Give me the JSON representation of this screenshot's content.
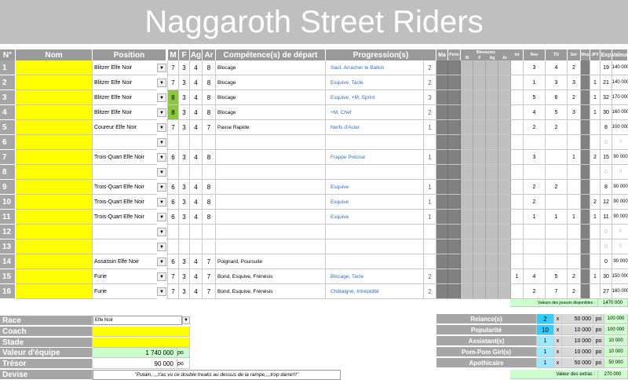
{
  "team_name": "Naggaroth Street Riders",
  "headers": {
    "no": "N°",
    "nom": "Nom",
    "position": "Position",
    "m": "M",
    "f": "F",
    "ag": "Ag",
    "ar": "Ar",
    "competences": "Compétence(s) de départ",
    "progression": "Progression(s)",
    "ma": "Ma",
    "pert": "Perte",
    "blessures": "Blessures",
    "bm": "M",
    "bf": "F",
    "bag": "Ag",
    "bar": "Ar",
    "int": "Int",
    "reu": "Reu",
    "td": "TD",
    "sor": "Sor",
    "mvp": "Mvp",
    "jpv": "JPV",
    "exp": "Exp",
    "valeur": "Valeur"
  },
  "players": [
    {
      "n": "1",
      "position": "Blitzer Elfe Noir",
      "m": "7",
      "f": "3",
      "ag": "4",
      "ar": "8",
      "m_up": false,
      "skills": "Blocage",
      "progression": "Saut, Arracher le Ballon",
      "prog_count": "2",
      "int": "",
      "reu": "3",
      "td": "4",
      "sor": "2",
      "mvp": "",
      "exp": "19",
      "valeur": "140 000",
      "empty": false
    },
    {
      "n": "2",
      "position": "Blitzer Elfe Noir",
      "m": "7",
      "f": "3",
      "ag": "4",
      "ar": "8",
      "m_up": false,
      "skills": "Blocage",
      "progression": "Esquive, Tacle",
      "prog_count": "2",
      "int": "",
      "reu": "1",
      "td": "3",
      "sor": "3",
      "mvp": "1",
      "exp": "21",
      "valeur": "140 000",
      "empty": false
    },
    {
      "n": "3",
      "position": "Blitzer Elfe Noir",
      "m": "8",
      "f": "3",
      "ag": "4",
      "ar": "8",
      "m_up": true,
      "skills": "Blocage",
      "progression": "Esquive,  +M, Sprint",
      "prog_count": "3",
      "int": "",
      "reu": "5",
      "td": "6",
      "sor": "2",
      "mvp": "1",
      "exp": "32",
      "valeur": "170 000",
      "empty": false
    },
    {
      "n": "4",
      "position": "Blitzer Elfe Noir",
      "m": "8",
      "f": "3",
      "ag": "4",
      "ar": "8",
      "m_up": true,
      "skills": "Blocage",
      "progression": " +M, Chef",
      "prog_count": "2",
      "int": "",
      "reu": "4",
      "td": "5",
      "sor": "3",
      "mvp": "1",
      "exp": "30",
      "valeur": "160 000",
      "empty": false
    },
    {
      "n": "5",
      "position": "Coureur Elfe Noir",
      "m": "7",
      "f": "3",
      "ag": "4",
      "ar": "7",
      "m_up": false,
      "skills": "Passe Rapide",
      "progression": "Nerfs d'Acier",
      "prog_count": "1",
      "int": "",
      "reu": "2",
      "td": "2",
      "sor": "",
      "mvp": "",
      "exp": "8",
      "valeur": "100 000",
      "empty": false
    },
    {
      "n": "6",
      "position": "",
      "m": "",
      "f": "",
      "ag": "",
      "ar": "",
      "m_up": false,
      "skills": "",
      "progression": "",
      "prog_count": "",
      "int": "",
      "reu": "",
      "td": "",
      "sor": "",
      "mvp": "",
      "exp": "0",
      "valeur": "0",
      "empty": true
    },
    {
      "n": "7",
      "position": "Trois-Quart Elfe Noir",
      "m": "6",
      "f": "3",
      "ag": "4",
      "ar": "8",
      "m_up": false,
      "skills": "",
      "progression": "Frappe Précise",
      "prog_count": "1",
      "int": "",
      "reu": "3",
      "td": "",
      "sor": "1",
      "mvp": "2",
      "exp": "15",
      "valeur": "90 000",
      "empty": false
    },
    {
      "n": "8",
      "position": "",
      "m": "",
      "f": "",
      "ag": "",
      "ar": "",
      "m_up": false,
      "skills": "",
      "progression": "",
      "prog_count": "",
      "int": "",
      "reu": "",
      "td": "",
      "sor": "",
      "mvp": "",
      "exp": "0",
      "valeur": "0",
      "empty": true
    },
    {
      "n": "9",
      "position": "Trois-Quart Elfe Noir",
      "m": "6",
      "f": "3",
      "ag": "4",
      "ar": "8",
      "m_up": false,
      "skills": "",
      "progression": "Esquive",
      "prog_count": "1",
      "int": "",
      "reu": "2",
      "td": "2",
      "sor": "",
      "mvp": "",
      "exp": "8",
      "valeur": "90 000",
      "empty": false
    },
    {
      "n": "10",
      "position": "Trois-Quart Elfe Noir",
      "m": "6",
      "f": "3",
      "ag": "4",
      "ar": "8",
      "m_up": false,
      "skills": "",
      "progression": "Esquive",
      "prog_count": "1",
      "int": "",
      "reu": "2",
      "td": "",
      "sor": "",
      "mvp": "2",
      "exp": "12",
      "valeur": "90 000",
      "empty": false
    },
    {
      "n": "11",
      "position": "Trois-Quart Elfe Noir",
      "m": "6",
      "f": "3",
      "ag": "4",
      "ar": "8",
      "m_up": false,
      "skills": "",
      "progression": "Esquive",
      "prog_count": "1",
      "int": "",
      "reu": "1",
      "td": "1",
      "sor": "1",
      "mvp": "1",
      "exp": "11",
      "valeur": "90 000",
      "empty": false
    },
    {
      "n": "12",
      "position": "",
      "m": "",
      "f": "",
      "ag": "",
      "ar": "",
      "m_up": false,
      "skills": "",
      "progression": "",
      "prog_count": "",
      "int": "",
      "reu": "",
      "td": "",
      "sor": "",
      "mvp": "",
      "exp": "0",
      "valeur": "0",
      "empty": true
    },
    {
      "n": "13",
      "position": "",
      "m": "",
      "f": "",
      "ag": "",
      "ar": "",
      "m_up": false,
      "skills": "",
      "progression": "",
      "prog_count": "",
      "int": "",
      "reu": "",
      "td": "",
      "sor": "",
      "mvp": "",
      "exp": "0",
      "valeur": "0",
      "empty": true
    },
    {
      "n": "14",
      "position": "Assassin Elfe Noir",
      "m": "6",
      "f": "3",
      "ag": "4",
      "ar": "7",
      "m_up": false,
      "skills": "Poignard, Poursuite",
      "progression": "",
      "prog_count": "",
      "int": "",
      "reu": "",
      "td": "",
      "sor": "",
      "mvp": "",
      "exp": "0",
      "valeur": "90 000",
      "empty": false
    },
    {
      "n": "15",
      "position": "Furie",
      "m": "7",
      "f": "3",
      "ag": "4",
      "ar": "7",
      "m_up": false,
      "skills": "Bond, Esquive, Frénésis",
      "progression": "Blocage, Tacle",
      "prog_count": "2",
      "int": "1",
      "reu": "4",
      "td": "5",
      "sor": "2",
      "mvp": "1",
      "exp": "30",
      "valeur": "150 000",
      "empty": false
    },
    {
      "n": "16",
      "position": "Furie",
      "m": "7",
      "f": "3",
      "ag": "4",
      "ar": "7",
      "m_up": false,
      "skills": "Bond, Esquive, Frénésis",
      "progression": "Châtaigne, Intrépidité",
      "prog_count": "2",
      "int": "",
      "reu": "2",
      "td": "7",
      "sor": "2",
      "mvp": "",
      "exp": "27",
      "valeur": "160 000",
      "empty": false
    }
  ],
  "players_total_label": "Valeurs des joueurs disponibles :",
  "players_total": "1470 000",
  "team": {
    "race_label": "Race",
    "race_value": "Elfe Noir",
    "coach_label": "Coach",
    "coach_value": "",
    "stade_label": "Stade",
    "stade_value": "",
    "valeur_label": "Valeur d'équipe",
    "valeur_value": "1 740 000",
    "valeur_unit": "po",
    "tresor_label": "Trésor",
    "tresor_value": "90 000",
    "tresor_unit": "po",
    "devise_label": "Devise",
    "devise_value": "\"Putain, ,,,t'as vu ce double treaks au dessus de la rampe,,,,trop darre!!!\""
  },
  "extras": [
    {
      "label": "Relance(s)",
      "qty": "2",
      "x": "x",
      "price": "50 000",
      "unit": "po",
      "total": "100 000"
    },
    {
      "label": "Popularité",
      "qty": "10",
      "x": "x",
      "price": "10 000",
      "unit": "po",
      "total": "100 000"
    },
    {
      "label": "Assistant(s)",
      "qty": "1",
      "x": "x",
      "price": "10 000",
      "unit": "po",
      "total": "10 000"
    },
    {
      "label": "Pom-Pom Girl(s)",
      "qty": "1",
      "x": "x",
      "price": "10 000",
      "unit": "po",
      "total": "10 000"
    },
    {
      "label": "Apothicaire",
      "qty": "1",
      "x": "x",
      "price": "50 000",
      "unit": "po",
      "total": "50 000"
    }
  ],
  "extras_total_label": "Valeur des extras :",
  "extras_total": "270 000",
  "icons": {
    "dropdown": "chevron-down-icon"
  },
  "colors": {
    "yellow": "#ffff00",
    "header_gray": "#a6a6a6",
    "cyan": "#33ccff",
    "green": "#8dc63f"
  }
}
